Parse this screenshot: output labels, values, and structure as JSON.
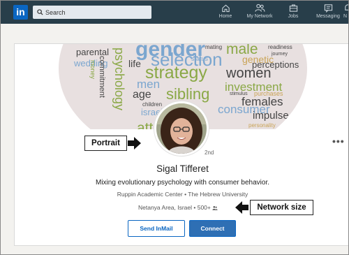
{
  "nav": {
    "logo_text": "in",
    "search_placeholder": "Search",
    "items": [
      {
        "label": "Home",
        "icon": "home-icon"
      },
      {
        "label": "My Network",
        "icon": "network-icon"
      },
      {
        "label": "Jobs",
        "icon": "briefcase-icon"
      },
      {
        "label": "Messaging",
        "icon": "messaging-icon"
      }
    ]
  },
  "banner": {
    "words": [
      "gender",
      "male",
      "parental",
      "psychology",
      "wedding",
      "commitment",
      "money",
      "life",
      "selection",
      "genetic",
      "perceptions",
      "strategy",
      "women",
      "investment",
      "men",
      "age",
      "sibling",
      "stimulus",
      "purchases",
      "females",
      "children",
      "israeli",
      "consumer",
      "impulse",
      "personality",
      "attention",
      "relationship",
      "mating",
      "status",
      "journey",
      "readiness"
    ]
  },
  "profile": {
    "degree": "2nd",
    "more": "•••",
    "name": "Sigal Tifferet",
    "headline": "Mixing evolutionary psychology with consumer behavior.",
    "school": "Ruppin Academic Center • The Hebrew University",
    "location": "Netanya Area, Israel • 500+"
  },
  "actions": {
    "send_inmail": "Send InMail",
    "connect": "Connect"
  },
  "annotations": {
    "portrait": "Portrait",
    "network_size": "Network size"
  },
  "colors": {
    "nav_bg": "#283e4a",
    "brand_blue": "#0a66c2",
    "connect_bg": "#2e6fb4"
  }
}
